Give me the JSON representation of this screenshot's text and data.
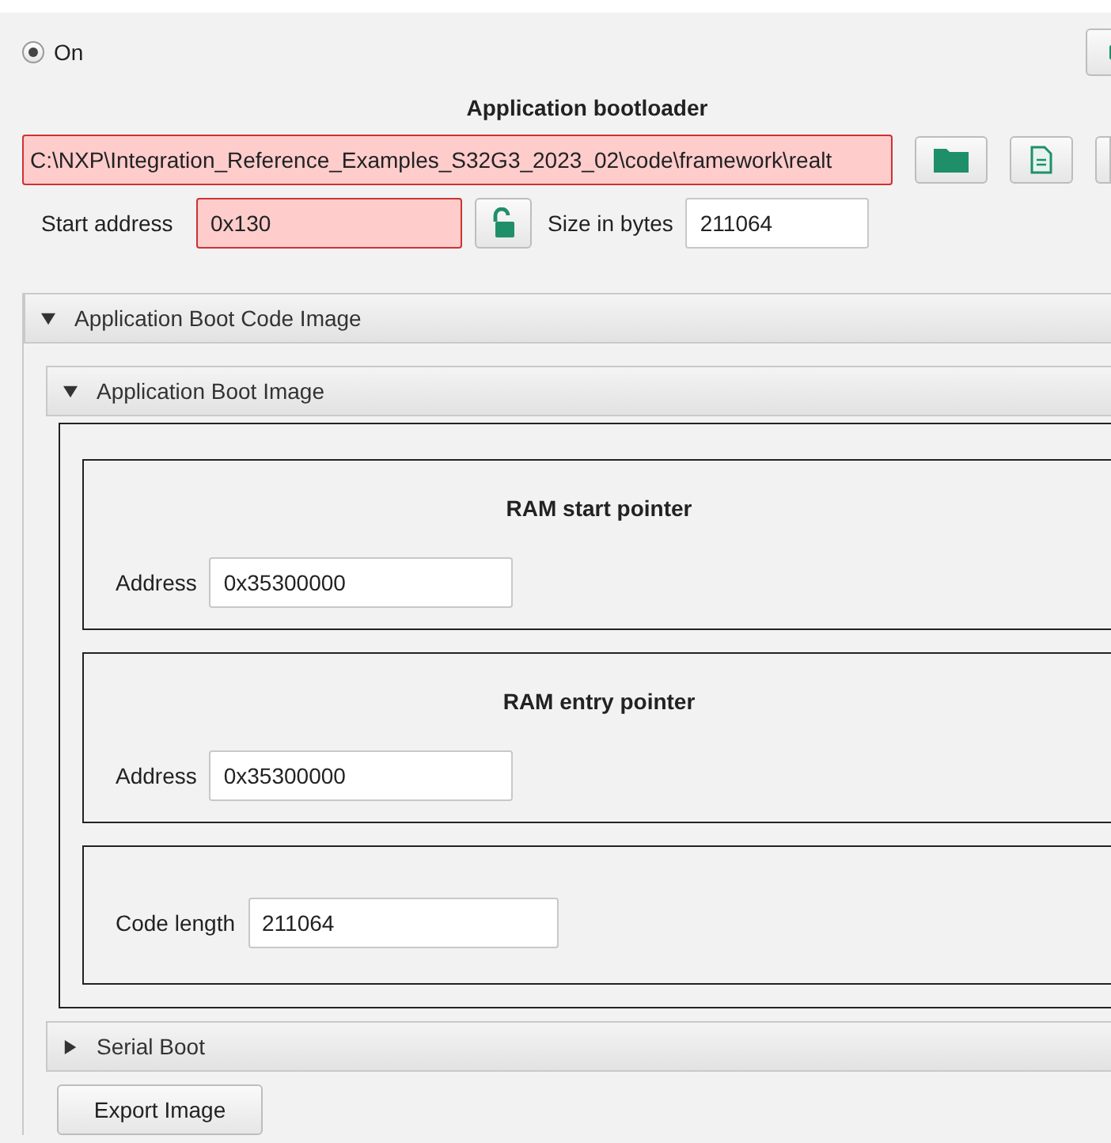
{
  "mode": {
    "label": "On",
    "selected": true
  },
  "bootloader": {
    "title": "Application bootloader",
    "path": {
      "value": "C:\\NXP\\Integration_Reference_Examples_S32G3_2023_02\\code\\framework\\realt",
      "error": true
    },
    "start_address": {
      "label": "Start address",
      "value": "0x130",
      "error": true
    },
    "size": {
      "label": "Size in bytes",
      "value": "211064",
      "error": false
    }
  },
  "section": {
    "title": "Application Boot Code Image",
    "expanded": true,
    "children": [
      {
        "title": "Application Boot Image",
        "expanded": true,
        "groups": [
          {
            "title": "RAM start pointer",
            "label": "Address",
            "value": "0x35300000"
          },
          {
            "title": "RAM entry pointer",
            "label": "Address",
            "value": "0x35300000"
          },
          {
            "label": "Code length",
            "value": "211064"
          }
        ]
      },
      {
        "title": "Serial Boot",
        "expanded": false
      }
    ]
  },
  "export_button": "Export Image"
}
